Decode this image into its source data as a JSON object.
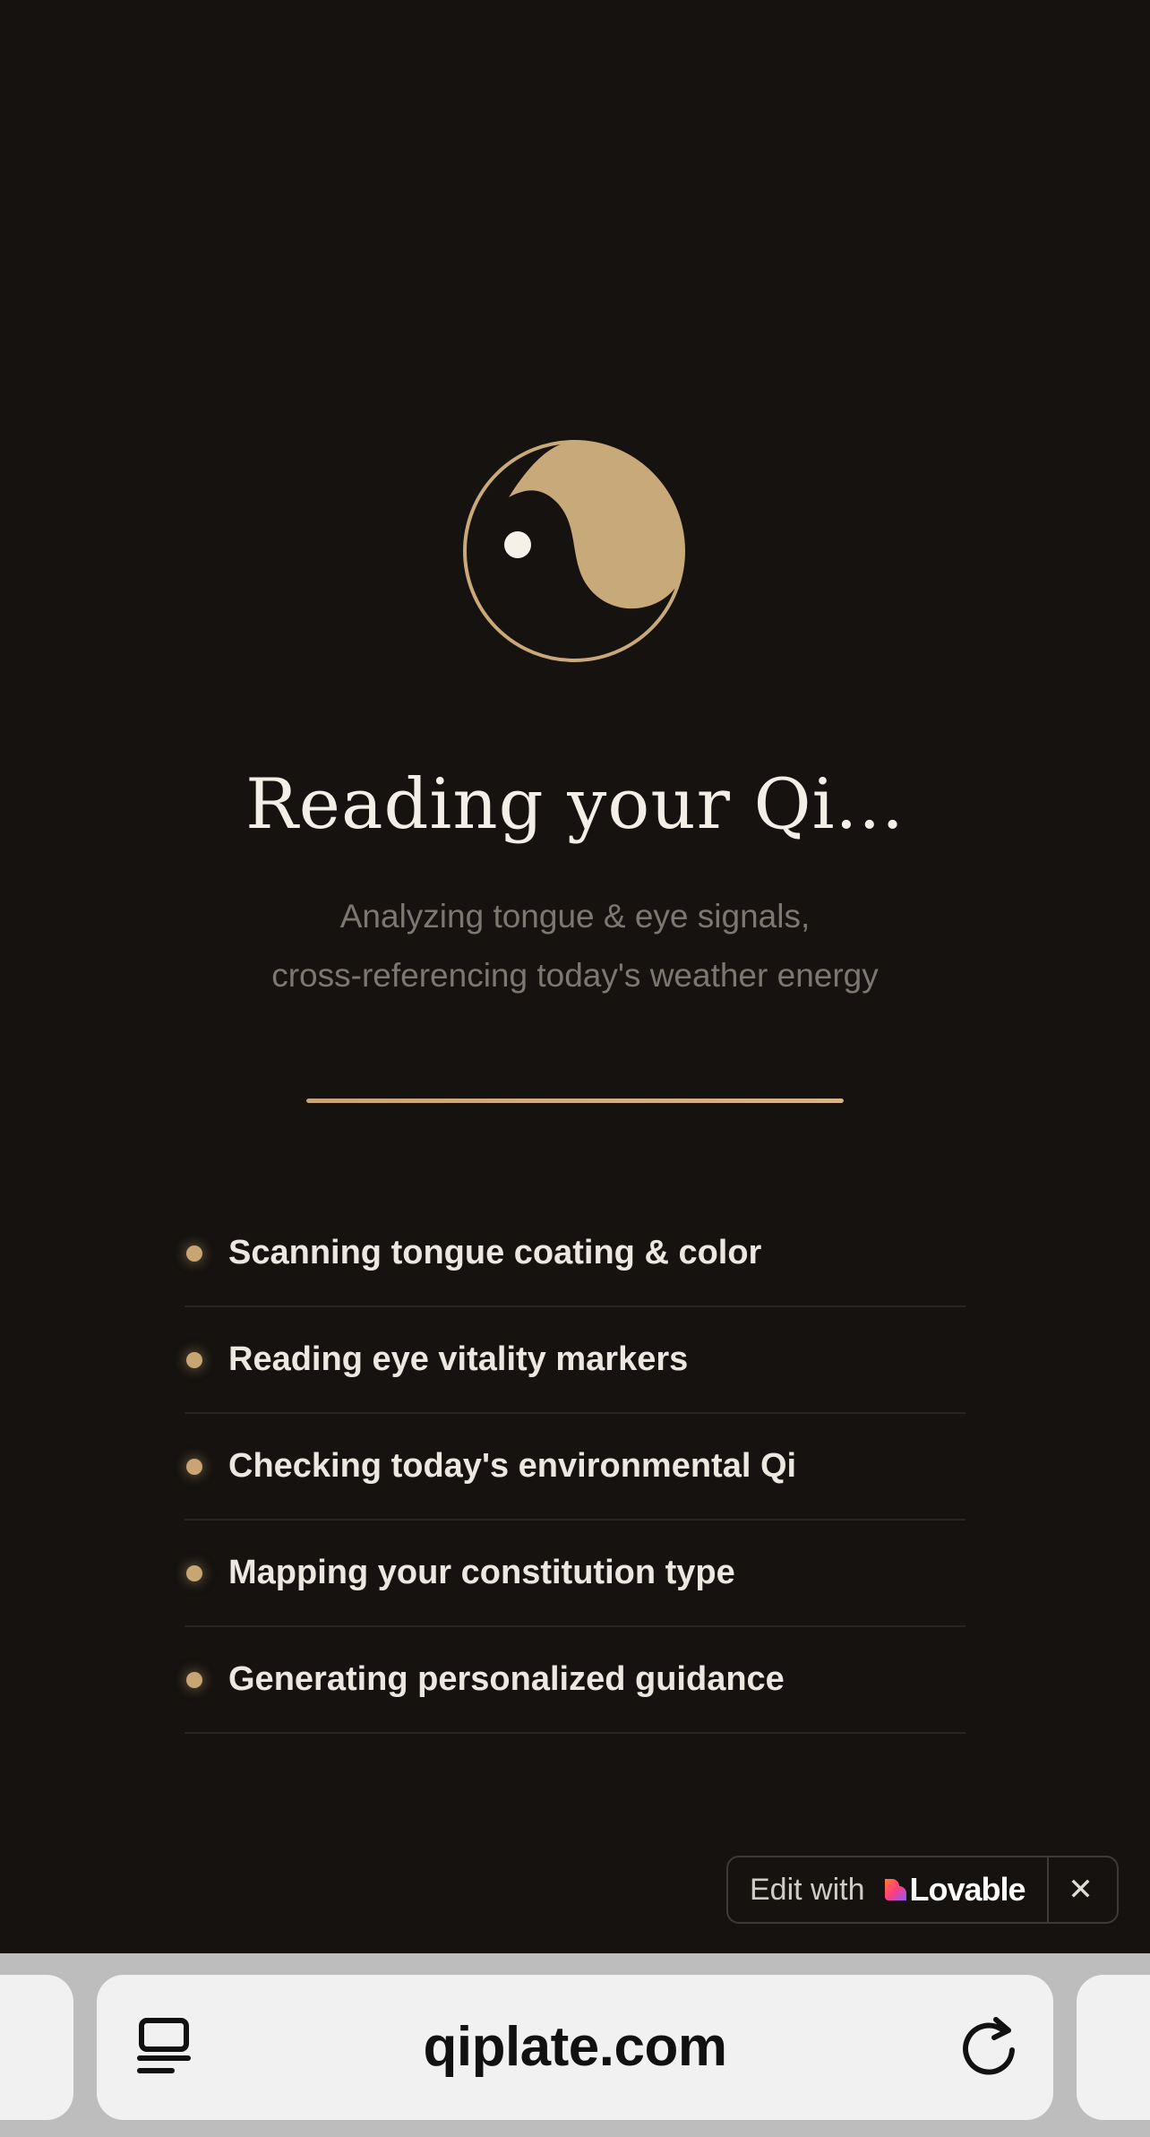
{
  "loading": {
    "title": "Reading your Qi...",
    "subtitle_lines": [
      "Analyzing tongue & eye signals,",
      "cross-referencing today's weather energy"
    ],
    "progress_percent": 100,
    "steps": [
      {
        "label": "Scanning tongue coating & color"
      },
      {
        "label": "Reading eye vitality markers"
      },
      {
        "label": "Checking today's environmental Qi"
      },
      {
        "label": "Mapping your constitution type"
      },
      {
        "label": "Generating personalized guidance"
      }
    ]
  },
  "badge": {
    "edit_text": "Edit with",
    "brand_text": "Lovable",
    "close_glyph": "✕"
  },
  "browser": {
    "url": "qiplate.com"
  },
  "colors": {
    "background": "#15120f",
    "accent_gold": "#c9a574",
    "title": "#f4efe6",
    "muted_text": "#7d7770"
  },
  "icons": {
    "logo": "yin-yang-icon",
    "step_marker": "bullet-dot-icon",
    "badge_logo": "lovable-heart-icon",
    "close": "close-icon",
    "reader": "reader-mode-icon",
    "reload": "reload-icon"
  }
}
